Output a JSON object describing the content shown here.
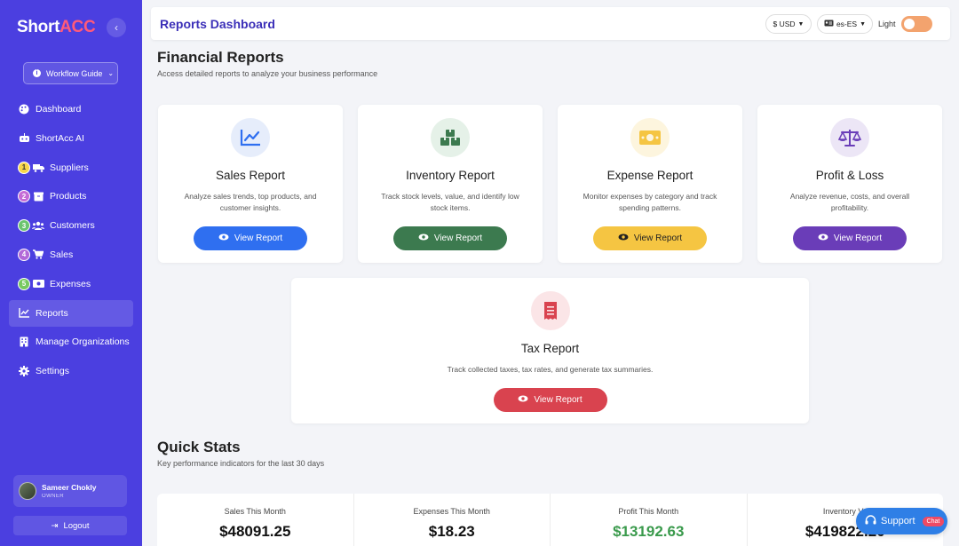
{
  "brand": {
    "part1": "Short",
    "part2": "ACC"
  },
  "sidebar": {
    "workflow_label": "Workflow Guide",
    "items": [
      {
        "label": "Dashboard",
        "icon": "palette-icon"
      },
      {
        "label": "ShortAcc AI",
        "icon": "robot-icon"
      },
      {
        "label": "Suppliers",
        "icon": "truck-icon",
        "step": "1"
      },
      {
        "label": "Products",
        "icon": "box-icon",
        "step": "2"
      },
      {
        "label": "Customers",
        "icon": "users-icon",
        "step": "3"
      },
      {
        "label": "Sales",
        "icon": "cart-icon",
        "step": "4"
      },
      {
        "label": "Expenses",
        "icon": "money-icon",
        "step": "5"
      },
      {
        "label": "Reports",
        "icon": "chart-line-icon",
        "active": true
      },
      {
        "label": "Manage Organizations",
        "icon": "building-icon"
      },
      {
        "label": "Settings",
        "icon": "gear-icon"
      }
    ],
    "user": {
      "name": "Sameer Chokly",
      "role": "OWNER"
    },
    "logout_label": "Logout"
  },
  "header": {
    "title": "Reports Dashboard",
    "currency": "$ USD",
    "language": "es-ES",
    "theme_label": "Light"
  },
  "financial": {
    "title": "Financial Reports",
    "subtitle": "Access detailed reports to analyze your business performance"
  },
  "reports": [
    {
      "title": "Sales Report",
      "desc": "Analyze sales trends, top products, and customer insights.",
      "button": "View Report"
    },
    {
      "title": "Inventory Report",
      "desc": "Track stock levels, value, and identify low stock items.",
      "button": "View Report"
    },
    {
      "title": "Expense Report",
      "desc": "Monitor expenses by category and track spending patterns.",
      "button": "View Report"
    },
    {
      "title": "Profit & Loss",
      "desc": "Analyze revenue, costs, and overall profitability.",
      "button": "View Report"
    },
    {
      "title": "Tax Report",
      "desc": "Track collected taxes, tax rates, and generate tax summaries.",
      "button": "View Report"
    }
  ],
  "quick": {
    "title": "Quick Stats",
    "subtitle": "Key performance indicators for the last 30 days"
  },
  "stats": [
    {
      "label": "Sales This Month",
      "value": "$48091.25"
    },
    {
      "label": "Expenses This Month",
      "value": "$18.23"
    },
    {
      "label": "Profit This Month",
      "value": "$13192.63"
    },
    {
      "label": "Inventory Va",
      "value": "$419822.20"
    }
  ],
  "support": {
    "label": "Support",
    "badge": "Chat"
  },
  "colors": {
    "sidebar": "#4b3fe0",
    "accent": "#3b2fb8",
    "profit": "#3a9a4c"
  }
}
